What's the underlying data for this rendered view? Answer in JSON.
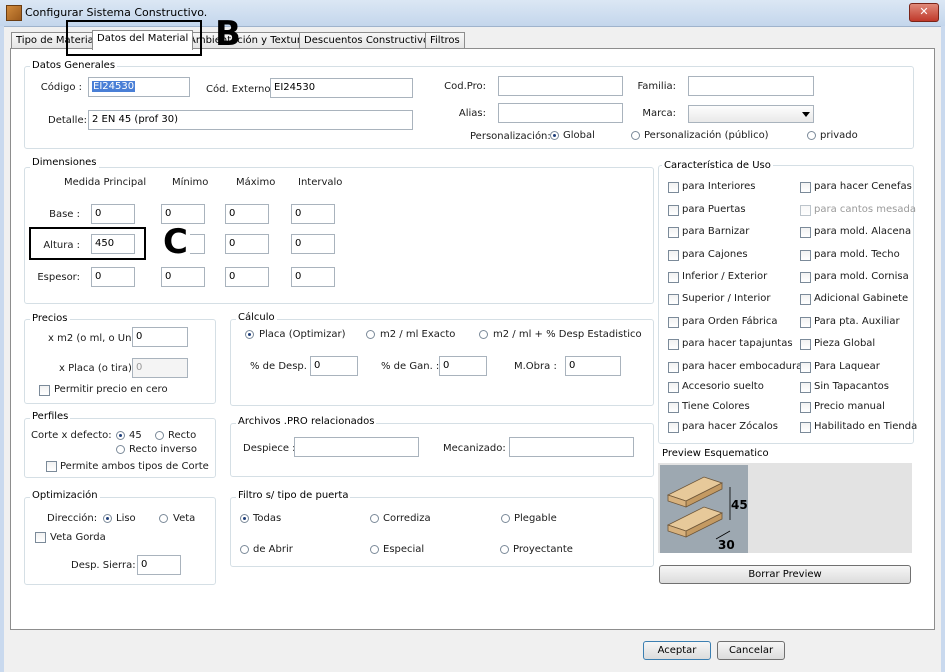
{
  "window": {
    "title": "Configurar Sistema Constructivo.",
    "close_glyph": "✕"
  },
  "tabs": [
    "Tipo de Material",
    "Datos del Material",
    "Ambientación y Texturas",
    "Descuentos Constructivos",
    "Filtros"
  ],
  "annotations": {
    "b": "B",
    "c": "C"
  },
  "datos_generales": {
    "title": "Datos Generales",
    "codigo_label": "Código :",
    "codigo_value": "EI24530",
    "cod_externo_label": "Cód. Externo :",
    "cod_externo_value": "EI24530",
    "detalle_label": "Detalle:",
    "detalle_value": "2 EN 45 (prof 30)",
    "codpro_label": "Cod.Pro:",
    "codpro_value": "",
    "alias_label": "Alias:",
    "alias_value": "",
    "familia_label": "Familia:",
    "familia_value": "",
    "marca_label": "Marca:",
    "marca_value": "",
    "personalizacion_label": "Personalización:",
    "options": [
      "Global",
      "Personalización (público)",
      "privado"
    ],
    "selected": "Global"
  },
  "dimensiones": {
    "title": "Dimensiones",
    "columns": [
      "Medida Principal",
      "Mínimo",
      "Máximo",
      "Intervalo"
    ],
    "rows": [
      {
        "label": "Base :",
        "values": [
          "0",
          "0",
          "0",
          "0"
        ]
      },
      {
        "label": "Altura :",
        "values": [
          "450",
          "",
          "0",
          "0"
        ]
      },
      {
        "label": "Espesor:",
        "values": [
          "0",
          "0",
          "0",
          "0"
        ]
      }
    ]
  },
  "precios": {
    "title": "Precios",
    "m2_label": "x m2 (o ml, o Un) :",
    "m2_value": "0",
    "placa_label": "x Placa (o tira) :",
    "placa_value": "0",
    "permitir_label": "Permitir precio en cero"
  },
  "calculo": {
    "title": "Cálculo",
    "options": [
      "Placa (Optimizar)",
      "m2 / ml Exacto",
      "m2 / ml + % Desp Estadistico"
    ],
    "selected": "Placa (Optimizar)",
    "desp_label": "% de Desp. :",
    "desp_value": "0",
    "gan_label": "% de Gan. :",
    "gan_value": "0",
    "mobra_label": "M.Obra :",
    "mobra_value": "0"
  },
  "perfiles": {
    "title": "Perfiles",
    "corte_label": "Corte x defecto:",
    "options": [
      "45",
      "Recto",
      "Recto inverso"
    ],
    "selected": "45",
    "ambos_label": "Permite ambos tipos de Corte"
  },
  "archivos": {
    "title": "Archivos .PRO relacionados",
    "despiece_label": "Despiece :",
    "despiece_value": "",
    "mecanizado_label": "Mecanizado:",
    "mecanizado_value": ""
  },
  "optimizacion": {
    "title": "Optimización",
    "direccion_label": "Dirección:",
    "options": [
      "Liso",
      "Veta"
    ],
    "selected": "Liso",
    "veta_gorda_label": "Veta Gorda",
    "desp_sierra_label": "Desp. Sierra:",
    "desp_sierra_value": "0"
  },
  "filtro_puerta": {
    "title": "Filtro s/ tipo de puerta",
    "options": [
      "Todas",
      "Corrediza",
      "Plegable",
      "de Abrir",
      "Especial",
      "Proyectante"
    ],
    "selected": "Todas"
  },
  "caracteristica_uso": {
    "title": "Característica de Uso",
    "left": [
      "para Interiores",
      "para Puertas",
      "para Barnizar",
      "para Cajones",
      "Inferior / Exterior",
      "Superior / Interior",
      "para Orden Fábrica",
      "para hacer tapajuntas",
      "para hacer embocaduras",
      "Accesorio suelto",
      "Tiene Colores",
      "para hacer Zócalos"
    ],
    "right": [
      "para hacer Cenefas",
      "para cantos mesada",
      "para mold. Alacena",
      "para mold. Techo",
      "para mold. Cornisa",
      "Adicional Gabinete",
      "Para pta. Auxiliar",
      "Pieza Global",
      "Para Laquear",
      "Sin Tapacantos",
      "Precio manual",
      "Habilitado en Tienda"
    ],
    "disabled_right_index": 1
  },
  "preview": {
    "title": "Preview Esquematico",
    "dim_height": "45",
    "dim_depth": "30",
    "borrar_label": "Borrar Preview"
  },
  "footer": {
    "aceptar": "Aceptar",
    "cancelar": "Cancelar"
  },
  "colors": {
    "selection": "#4a7fd6",
    "title_bar": "#c4d6ec",
    "group_border": "#d5dfe5"
  }
}
